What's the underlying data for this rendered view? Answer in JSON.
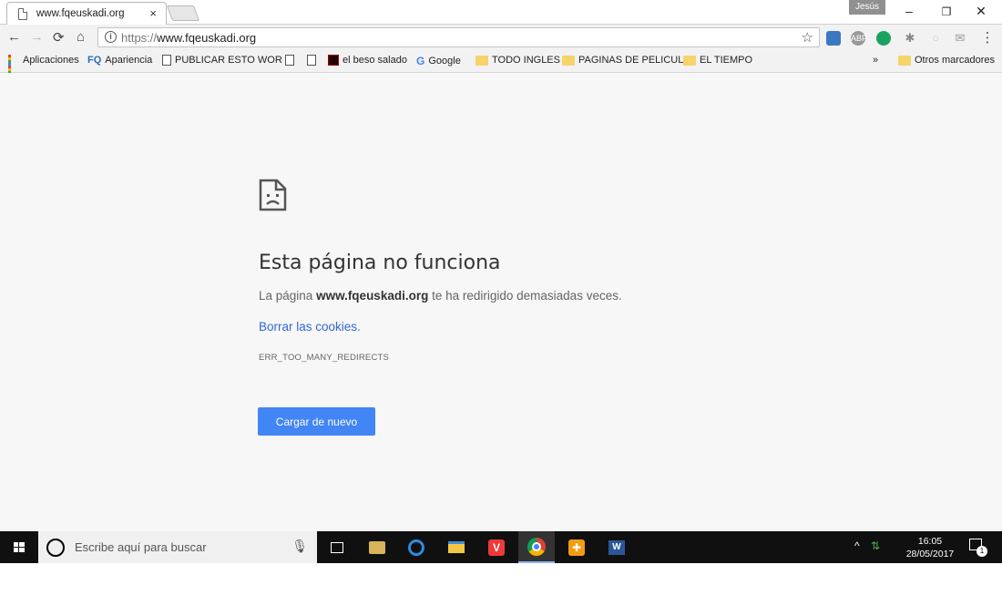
{
  "browser": {
    "tab_title": "www.fqeuskadi.org",
    "tab_close": "×",
    "user_label": "Jesús",
    "window_minimize": "–",
    "window_restore": "❐",
    "window_close": "✕",
    "url_scheme": "https://",
    "url_host": "www.fqeuskadi.org"
  },
  "bookmarks": {
    "items": [
      {
        "label": "Aplicaciones"
      },
      {
        "label": "Apariencia"
      },
      {
        "label": "PUBLICAR ESTO WOR"
      },
      {
        "label": ""
      },
      {
        "label": ""
      },
      {
        "label": "el beso salado"
      },
      {
        "label": "Google"
      },
      {
        "label": "TODO INGLES"
      },
      {
        "label": "PAGINAS DE PELICUL"
      },
      {
        "label": "EL TIEMPO"
      }
    ],
    "overflow": "»",
    "other": "Otros marcadores"
  },
  "error_page": {
    "title": "Esta página no funciona",
    "desc_prefix": "La página ",
    "desc_host": "www.fqeuskadi.org",
    "desc_suffix": " te ha redirigido demasiadas veces.",
    "link": "Borrar las cookies.",
    "code": "ERR_TOO_MANY_REDIRECTS",
    "reload_button": "Cargar de nuevo"
  },
  "taskbar": {
    "search_placeholder": "Escribe aquí para buscar",
    "time": "16:05",
    "date": "28/05/2017",
    "notification_count": "1"
  },
  "colors": {
    "accent": "#4285f4",
    "link": "#3367d6"
  }
}
